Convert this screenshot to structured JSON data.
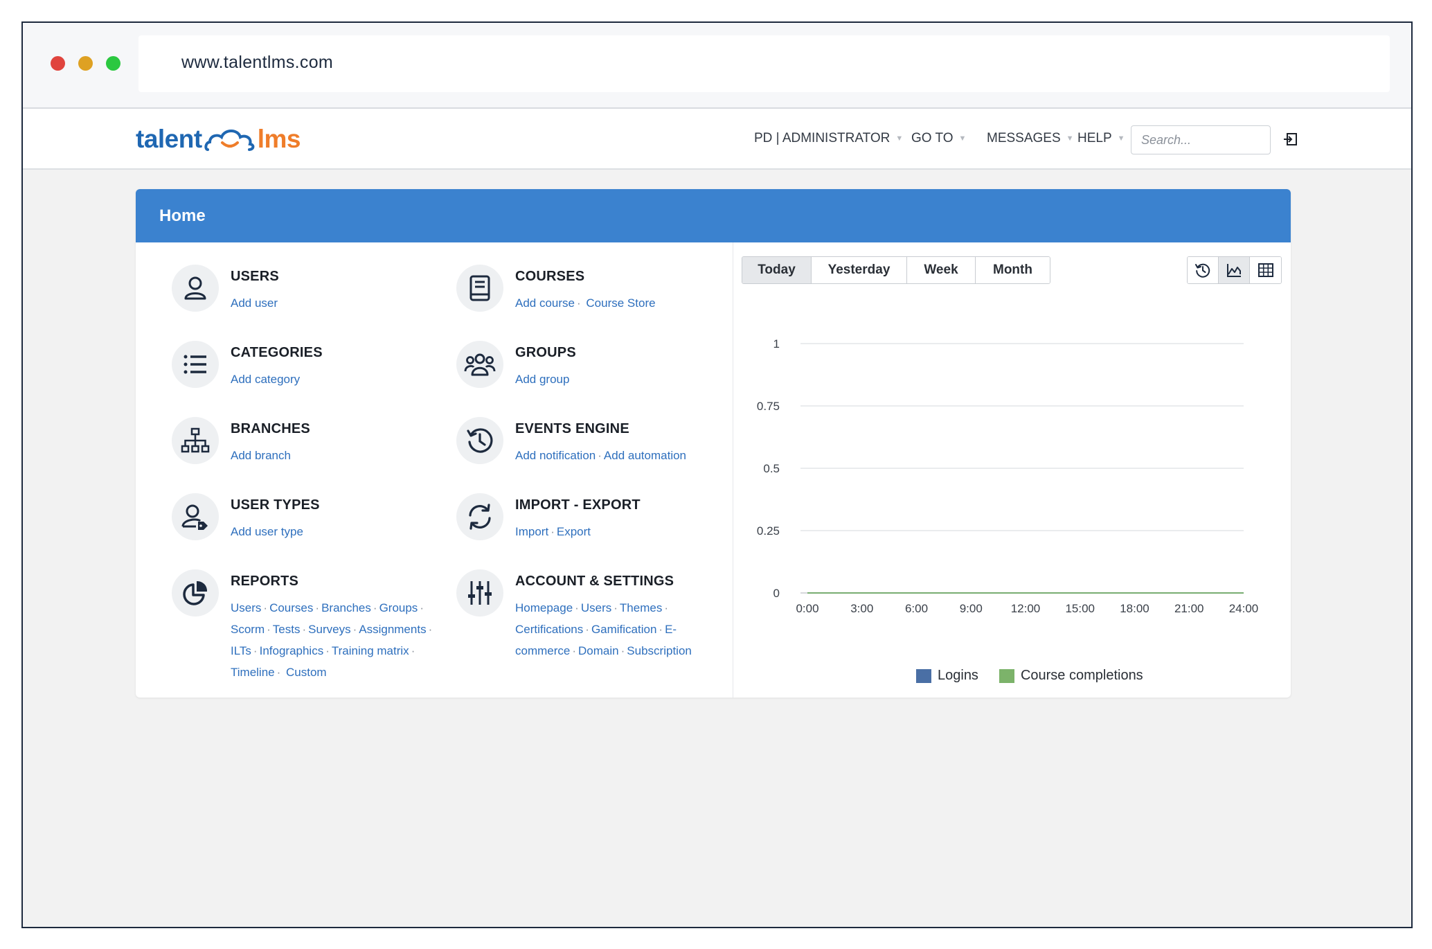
{
  "browser": {
    "url": "www.talentlms.com"
  },
  "logo": {
    "left": "talent",
    "right": "lms"
  },
  "nav": {
    "admin": "PD | ADMINISTRATOR",
    "goto": "GO TO",
    "messages": "MESSAGES",
    "help": "HELP",
    "search_placeholder": "Search..."
  },
  "panel": {
    "title": "Home"
  },
  "left_items": [
    {
      "title": "USERS",
      "links": [
        "Add user"
      ]
    },
    {
      "title": "CATEGORIES",
      "links": [
        "Add category"
      ]
    },
    {
      "title": "BRANCHES",
      "links": [
        "Add branch"
      ]
    },
    {
      "title": "USER TYPES",
      "links": [
        "Add user type"
      ]
    },
    {
      "title": "REPORTS",
      "links": [
        "Users",
        "Courses",
        "Branches",
        "Groups",
        "Scorm",
        "Tests",
        "Surveys",
        "Assignments",
        "ILTs",
        "Infographics",
        "Training matrix",
        "Timeline",
        "Custom"
      ]
    }
  ],
  "right_items": [
    {
      "title": "COURSES",
      "links": [
        "Add course",
        "Course Store"
      ]
    },
    {
      "title": "GROUPS",
      "links": [
        "Add group"
      ]
    },
    {
      "title": "EVENTS ENGINE",
      "links": [
        "Add notification",
        "Add automation"
      ]
    },
    {
      "title": "IMPORT - EXPORT",
      "links": [
        "Import",
        "Export"
      ]
    },
    {
      "title": "ACCOUNT & SETTINGS",
      "links": [
        "Homepage",
        "Users",
        "Themes",
        "Certifications",
        "Gamification",
        "E-commerce",
        "Domain",
        "Subscription"
      ]
    }
  ],
  "range_buttons": [
    "Today",
    "Yesterday",
    "Week",
    "Month"
  ],
  "active_range": "Today",
  "view_buttons": [
    "history-icon",
    "area-chart-icon",
    "table-grid-icon"
  ],
  "active_view": "area-chart-icon",
  "colors": {
    "accent": "#3b82cf",
    "link": "#2e6fbd",
    "logins": "#4a6fa5",
    "completions": "#7cb36a"
  },
  "chart_data": {
    "type": "line",
    "x": [
      "0:00",
      "3:00",
      "6:00",
      "9:00",
      "12:00",
      "15:00",
      "18:00",
      "21:00",
      "24:00"
    ],
    "y_ticks": [
      "0",
      "0.25",
      "0.5",
      "0.75",
      "1"
    ],
    "ylim": [
      0,
      1
    ],
    "grid": true,
    "legend_position": "bottom",
    "series": [
      {
        "name": "Logins",
        "color": "#4a6fa5",
        "values": [
          0,
          0,
          0,
          0,
          0,
          0,
          0,
          0,
          0
        ]
      },
      {
        "name": "Course completions",
        "color": "#7cb36a",
        "values": [
          0,
          0,
          0,
          0,
          0,
          0,
          0,
          0,
          0
        ]
      }
    ]
  }
}
